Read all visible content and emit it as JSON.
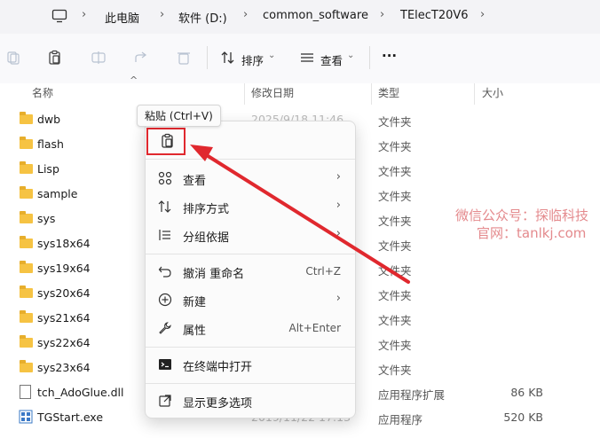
{
  "breadcrumb": {
    "items": [
      "此电脑",
      "软件 (D:)",
      "common_software",
      "TElecT20V6"
    ]
  },
  "toolbar": {
    "sort_label": "排序",
    "view_label": "查看",
    "more_label": "···"
  },
  "columns": {
    "name": "名称",
    "date": "修改日期",
    "type": "类型",
    "size": "大小"
  },
  "files": [
    {
      "name": "dwb",
      "date": "2025/9/18 11:46",
      "type": "文件夹",
      "size": "",
      "icon": "folder-icon"
    },
    {
      "name": "flash",
      "date": "",
      "type": "文件夹",
      "size": "",
      "icon": "folder-icon"
    },
    {
      "name": "Lisp",
      "date": "",
      "type": "文件夹",
      "size": "",
      "icon": "folder-icon"
    },
    {
      "name": "sample",
      "date": "",
      "type": "文件夹",
      "size": "",
      "icon": "folder-icon"
    },
    {
      "name": "sys",
      "date": "",
      "type": "文件夹",
      "size": "",
      "icon": "folder-icon"
    },
    {
      "name": "sys18x64",
      "date": "",
      "type": "文件夹",
      "size": "",
      "icon": "folder-icon"
    },
    {
      "name": "sys19x64",
      "date": "",
      "type": "文件夹",
      "size": "",
      "icon": "folder-icon"
    },
    {
      "name": "sys20x64",
      "date": "",
      "type": "文件夹",
      "size": "",
      "icon": "folder-icon"
    },
    {
      "name": "sys21x64",
      "date": "",
      "type": "文件夹",
      "size": "",
      "icon": "folder-icon"
    },
    {
      "name": "sys22x64",
      "date": "",
      "type": "文件夹",
      "size": "",
      "icon": "folder-icon"
    },
    {
      "name": "sys23x64",
      "date": "",
      "type": "文件夹",
      "size": "",
      "icon": "folder-icon"
    },
    {
      "name": "tch_AdoGlue.dll",
      "date": "",
      "type": "应用程序扩展",
      "size": "86 KB",
      "icon": "dll-file-icon"
    },
    {
      "name": "TGStart.exe",
      "date": "2019/11/22 17:13",
      "type": "应用程序",
      "size": "520 KB",
      "icon": "exe-file-icon"
    }
  ],
  "tooltip": "粘贴 (Ctrl+V)",
  "context_menu": {
    "view": "查看",
    "sort_by": "排序方式",
    "group_by": "分组依据",
    "undo": "撤消 重命名",
    "undo_shortcut": "Ctrl+Z",
    "new": "新建",
    "properties": "属性",
    "properties_shortcut": "Alt+Enter",
    "open_in_terminal": "在终端中打开",
    "show_more": "显示更多选项"
  },
  "watermark": {
    "line1": "微信公众号：探临科技",
    "line2": "官网：tanlkj.com"
  },
  "colors": {
    "annotation_red": "#e0282e",
    "folder_yellow": "#f6c343",
    "watermark": "#e48a8d"
  }
}
